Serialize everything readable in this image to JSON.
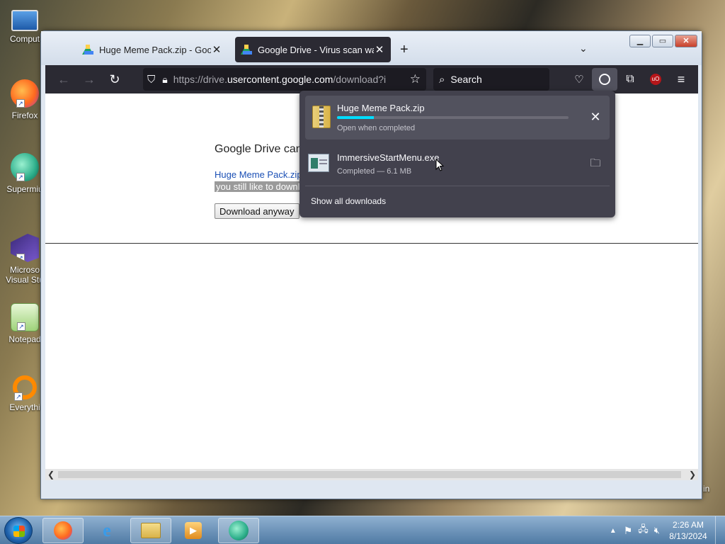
{
  "desktop": {
    "icons": [
      {
        "label": "Comput",
        "icon": "computer-icon"
      },
      {
        "label": "Firefox",
        "icon": "firefox-icon"
      },
      {
        "label": "Supermiu",
        "icon": "supermium-icon"
      },
      {
        "label": "Microso",
        "label2": "Visual Stu",
        "icon": "visual-studio-icon"
      },
      {
        "label": "Notepad",
        "icon": "notepad-icon"
      },
      {
        "label": "Everythi",
        "icon": "everything-icon"
      }
    ],
    "partial_right_label": "in"
  },
  "browser": {
    "tabs": [
      {
        "title": "Huge Meme Pack.zip - Google Dri",
        "active": false
      },
      {
        "title": "Google Drive - Virus scan warnin",
        "active": true
      }
    ],
    "new_tab_label": "+",
    "url_prefix": "https://drive.",
    "url_host": "usercontent.google.com",
    "url_path": "/download?id",
    "search_placeholder": "Search",
    "extension_badge": "uO"
  },
  "page": {
    "title": "Google Drive can",
    "file_link": "Huge Meme Pack.zip",
    "selected_text": "you still like to downl",
    "download_button": "Download anyway"
  },
  "downloads": {
    "items": [
      {
        "name": "Huge Meme Pack.zip",
        "status": "Open when completed",
        "progress": 0.16,
        "icon": "zip-folder-icon",
        "action": "cancel"
      },
      {
        "name": "ImmersiveStartMenu.exe",
        "status": "Completed — 6.1 MB",
        "icon": "exe-icon",
        "action": "open-folder"
      }
    ],
    "show_all": "Show all downloads"
  },
  "taskbar": {
    "apps": [
      "firefox",
      "internet-explorer",
      "file-explorer",
      "media-player",
      "supermium"
    ],
    "time": "2:26 AM",
    "date": "8/13/2024"
  },
  "colors": {
    "toolbar": "#2b2a33",
    "panel": "#42414d",
    "progress": "#00ddff"
  }
}
